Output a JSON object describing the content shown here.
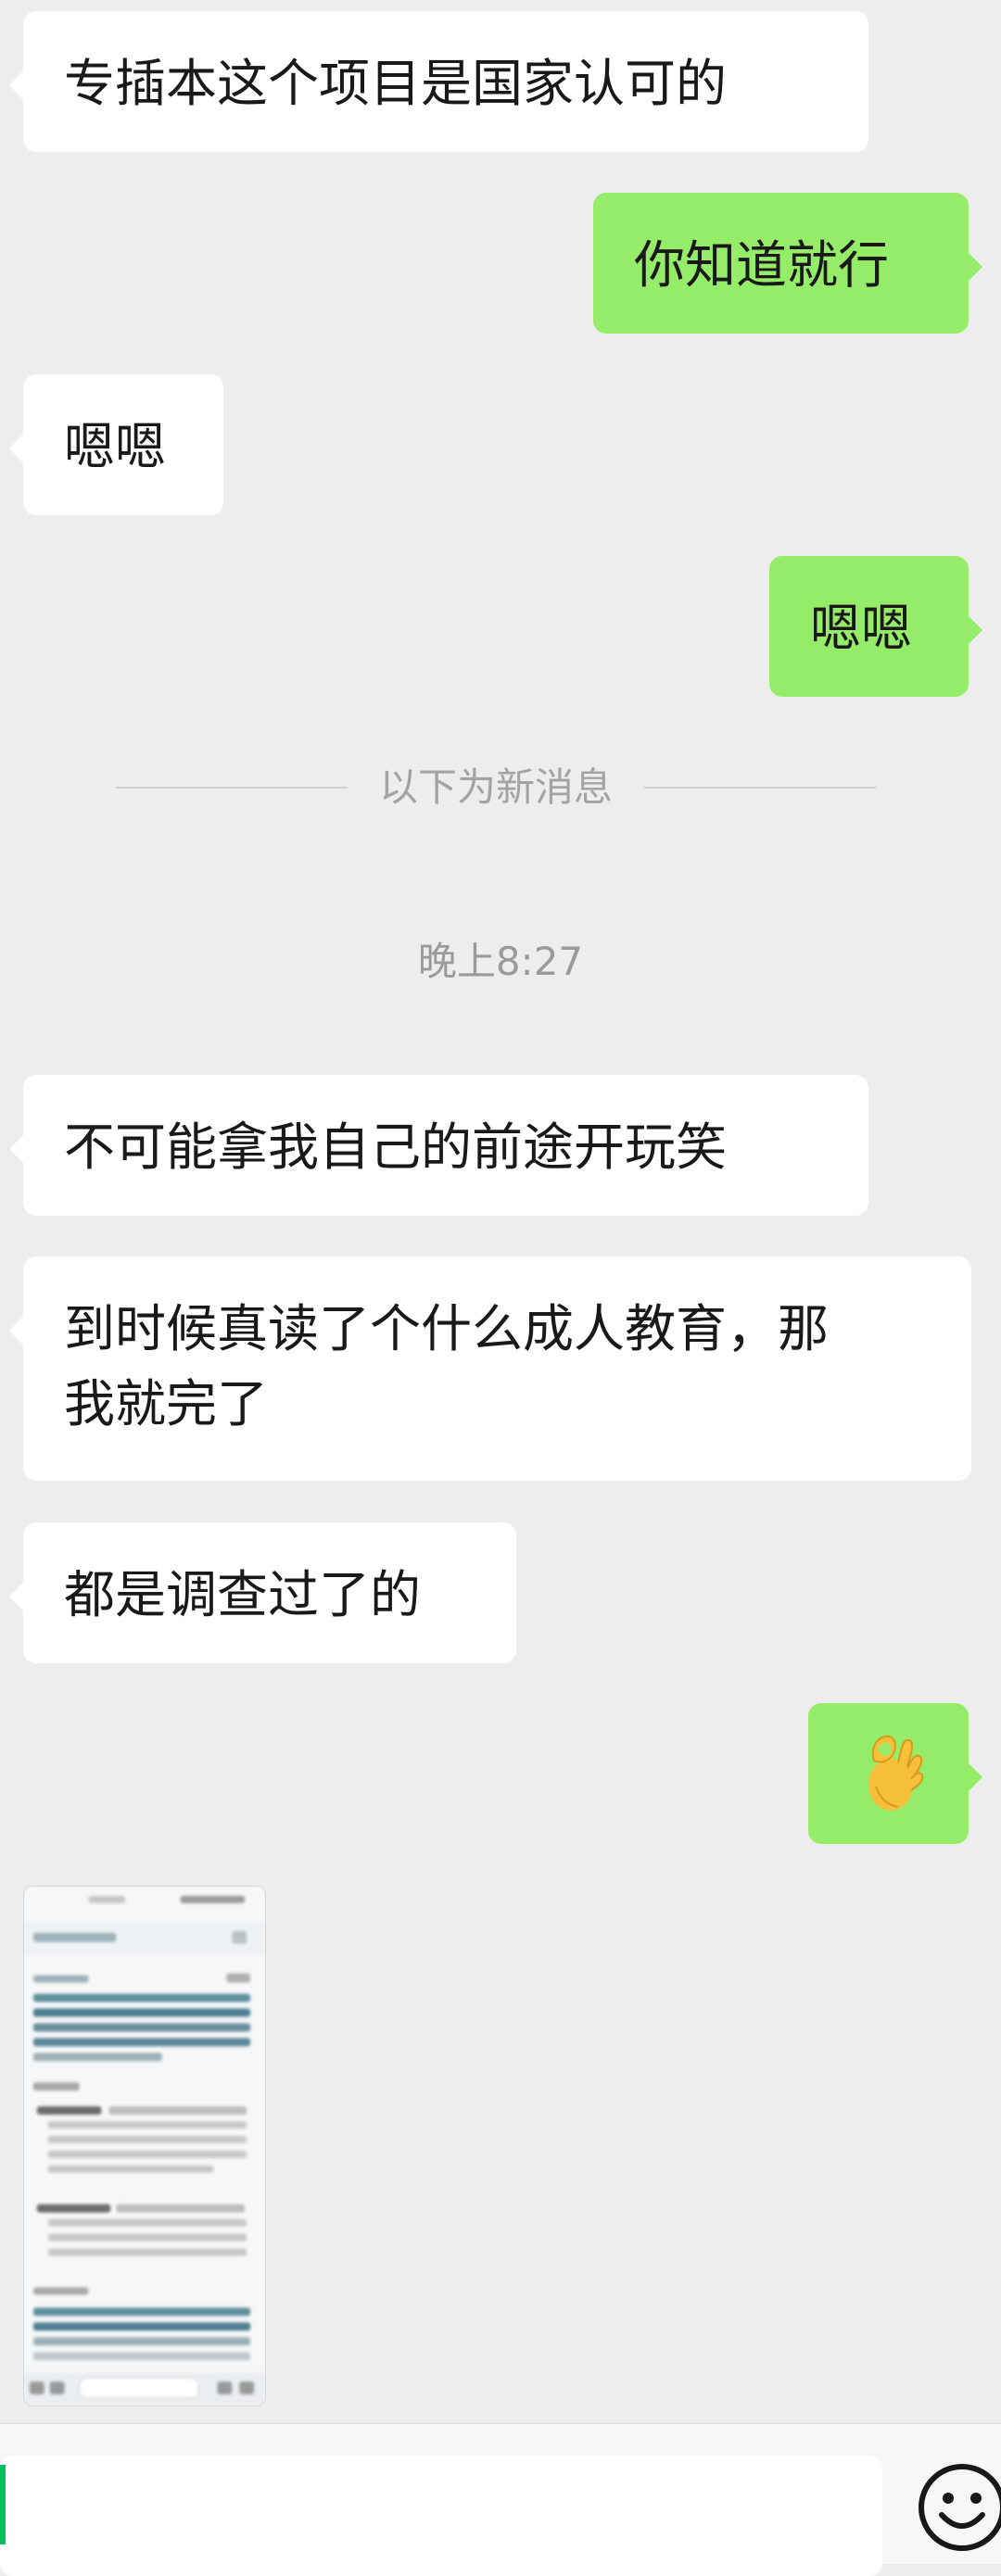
{
  "messages": [
    {
      "side": "in",
      "text": "专插本这个项目是国家认可的"
    },
    {
      "side": "out",
      "text": "你知道就行"
    },
    {
      "side": "in",
      "text": "嗯嗯"
    },
    {
      "side": "out",
      "text": "嗯嗯"
    },
    {
      "side": "in",
      "text": "不可能拿我自己的前途开玩笑"
    },
    {
      "side": "in",
      "lines": [
        "到时候真读了个什么成人教育，那",
        "我就完了"
      ]
    },
    {
      "side": "in",
      "text": "都是调查过了的"
    },
    {
      "side": "out",
      "emoji": "ok-hand"
    }
  ],
  "divider_text": "以下为新消息",
  "timestamp": "晚上8:27",
  "input": {
    "value": ""
  },
  "colors": {
    "background": "#ededed",
    "incoming_bubble": "#ffffff",
    "outgoing_bubble": "#95ec69",
    "cursor": "#07c160"
  },
  "icons": {
    "emoji_button": "smiley-face-icon",
    "ok_emoji": "ok-hand-emoji-icon"
  }
}
